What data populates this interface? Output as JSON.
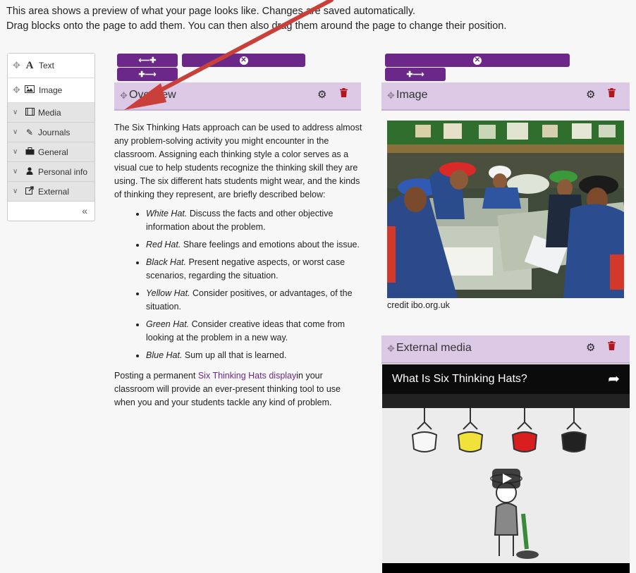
{
  "intro": {
    "line1": "This area shows a preview of what your page looks like. Changes are saved automatically.",
    "line2": "Drag blocks onto the page to add them. You can then also drag them around the page to change their position."
  },
  "palette": {
    "items": [
      {
        "label": "Text",
        "icon": "text-icon"
      },
      {
        "label": "Image",
        "icon": "image-icon"
      }
    ],
    "categories": [
      {
        "label": "Media",
        "icon": "film-icon"
      },
      {
        "label": "Journals",
        "icon": "pencil-icon"
      },
      {
        "label": "General",
        "icon": "briefcase-icon"
      },
      {
        "label": "Personal info",
        "icon": "user-icon"
      },
      {
        "label": "External",
        "icon": "external-link-icon"
      }
    ],
    "collapse_label": "«"
  },
  "overview_block": {
    "title": "Overview",
    "intro": "The Six Thinking Hats approach can be used to address almost any problem-solving activity you might encounter in the classroom. Assigning each thinking style a color serves as a visual cue to help students recognize the thinking skill they are using. The six different hats students might wear, and the kinds of thinking they represent, are briefly described below:",
    "hats": [
      {
        "name": "White Hat.",
        "text": " Discuss the facts and other objective information about the problem."
      },
      {
        "name": "Red Hat.",
        "text": " Share feelings and emotions about the issue."
      },
      {
        "name": "Black Hat.",
        "text": " Present negative aspects, or worst case scenarios, regarding the situation."
      },
      {
        "name": "Yellow Hat.",
        "text": " Consider positives, or advantages, of the situation."
      },
      {
        "name": "Green Hat.",
        "text": " Consider creative ideas that come from looking at the problem in a new way."
      },
      {
        "name": "Blue Hat.",
        "text": " Sum up all that is learned."
      }
    ],
    "outro_before": "Posting a permanent ",
    "outro_link": "Six Thinking Hats display",
    "outro_after": "in your classroom will provide an ever-present thinking tool to use when you and your students tackle any kind of problem."
  },
  "image_block": {
    "title": "Image",
    "caption": "credit ibo.org.uk"
  },
  "external_block": {
    "title": "External media",
    "video_title": "What Is Six Thinking Hats?"
  },
  "colors": {
    "accent": "#6b2889",
    "block_header": "#dcc9e6",
    "delete": "#b3171d"
  }
}
